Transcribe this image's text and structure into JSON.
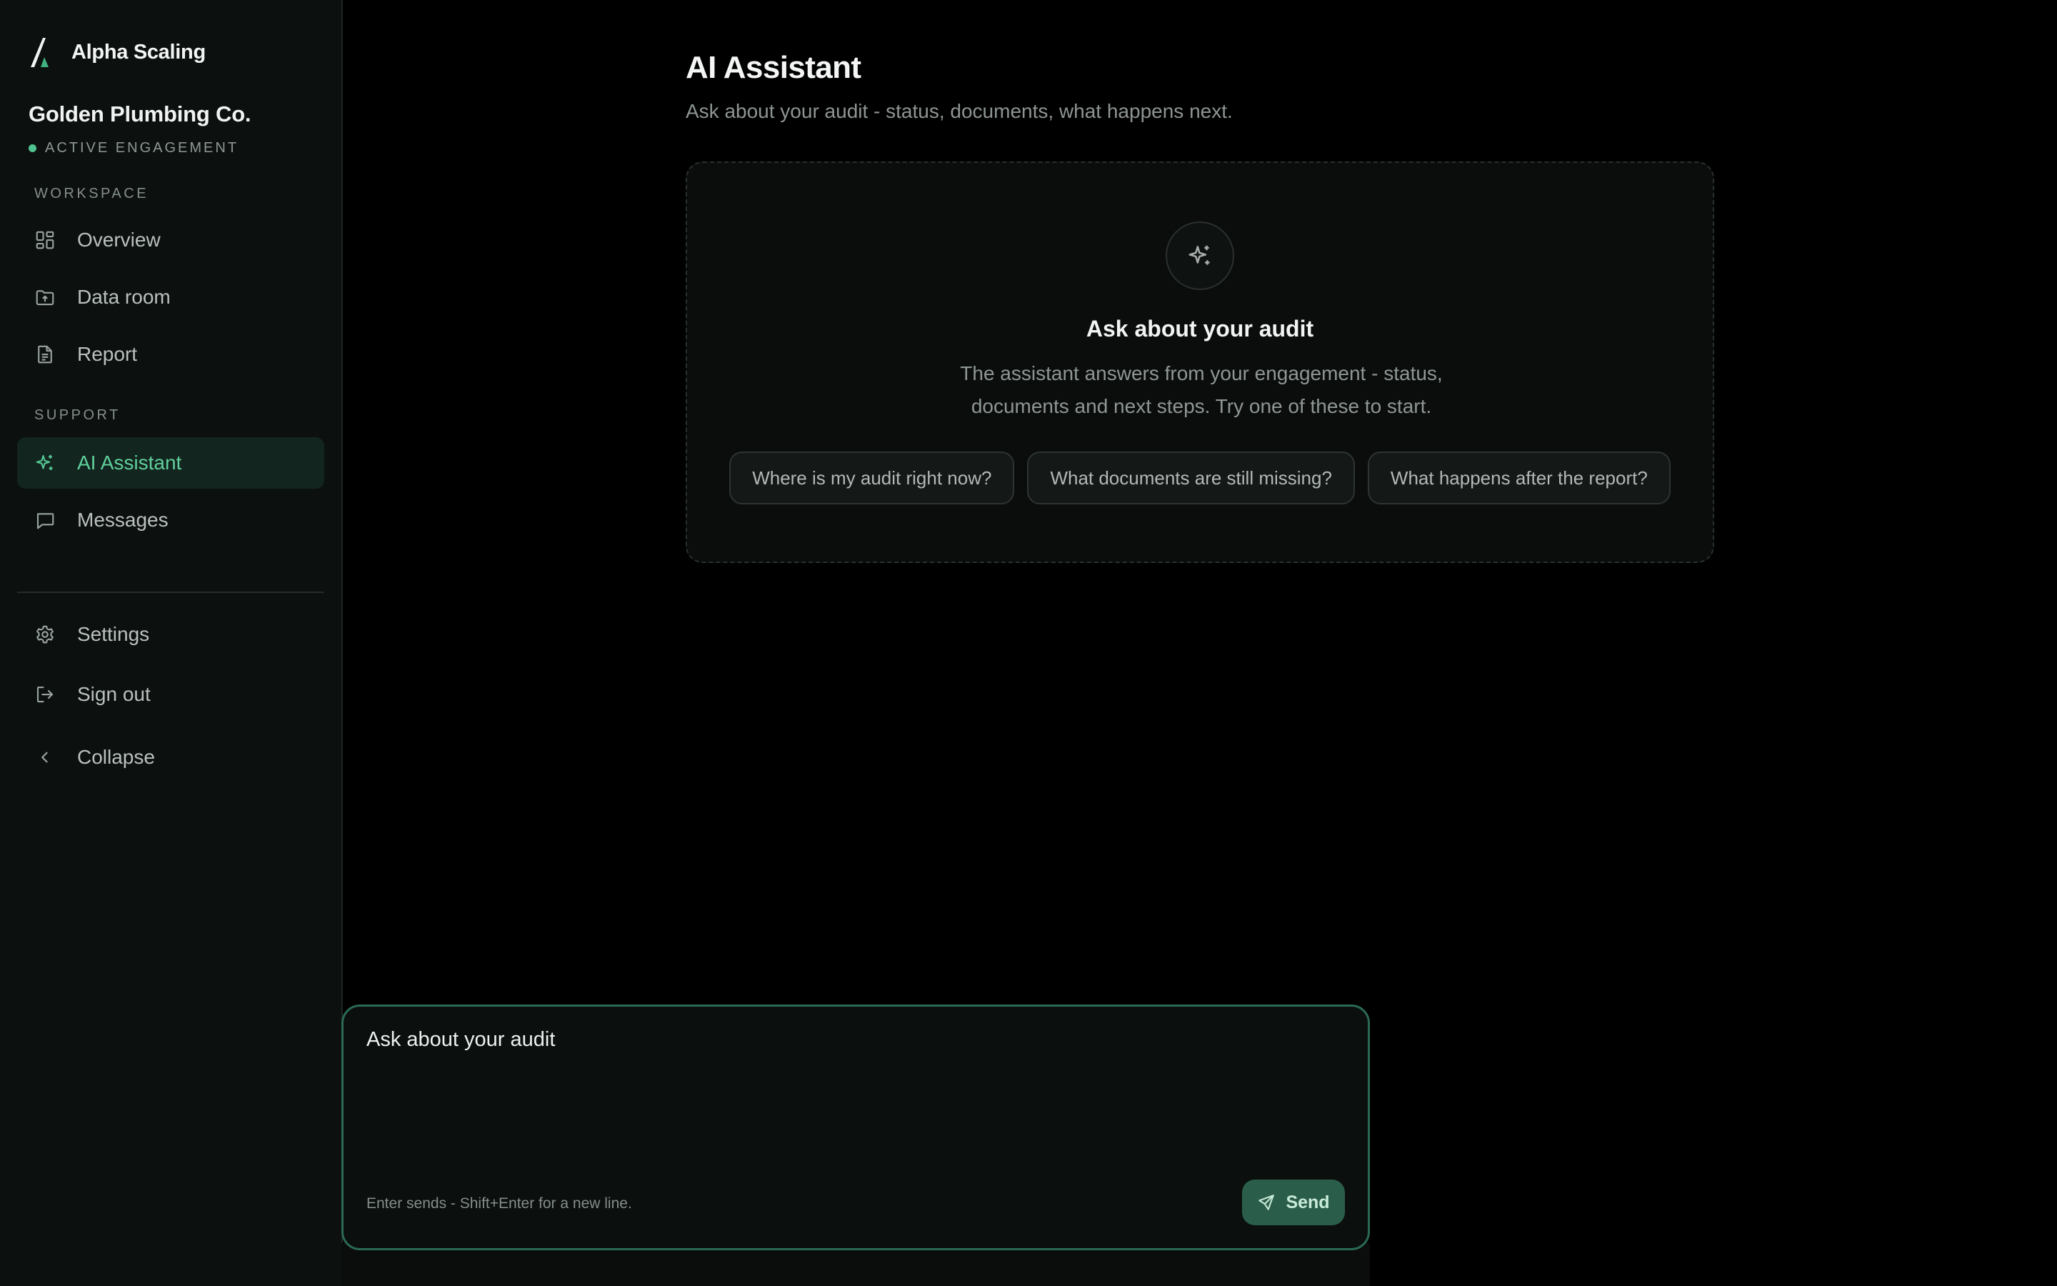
{
  "brand": {
    "name": "Alpha Scaling"
  },
  "client": {
    "name": "Golden Plumbing Co.",
    "status": "ACTIVE ENGAGEMENT",
    "status_color": "#4fc38f"
  },
  "sidebar": {
    "workspace_label": "WORKSPACE",
    "workspace_items": [
      {
        "label": "Overview",
        "icon": "grid-icon"
      },
      {
        "label": "Data room",
        "icon": "folder-upload-icon"
      },
      {
        "label": "Report",
        "icon": "document-icon"
      }
    ],
    "support_label": "SUPPORT",
    "support_items": [
      {
        "label": "AI Assistant",
        "icon": "sparkles-icon",
        "active": true
      },
      {
        "label": "Messages",
        "icon": "chat-bubble-icon"
      }
    ],
    "footer_items": [
      {
        "label": "Settings",
        "icon": "gear-icon"
      },
      {
        "label": "Sign out",
        "icon": "logout-icon"
      },
      {
        "label": "Collapse",
        "icon": "chevron-left-icon"
      }
    ]
  },
  "page": {
    "title": "AI Assistant",
    "subtitle": "Ask about your audit - status, documents, what happens next."
  },
  "empty_state": {
    "icon": "sparkles-icon",
    "title": "Ask about your audit",
    "description": "The assistant answers from your engagement - status, documents and next steps. Try one of these to start.",
    "suggestions": [
      "Where is my audit right now?",
      "What documents are still missing?",
      "What happens after the report?"
    ]
  },
  "composer": {
    "placeholder": "Ask about your audit",
    "value": "",
    "hint": "Enter sends - Shift+Enter for a new line.",
    "send_label": "Send",
    "send_icon": "send-icon"
  },
  "colors": {
    "accent": "#5fd09c",
    "active_bg": "#13251f",
    "sidebar_bg": "#0c1110",
    "send_button_bg": "#2b5e4a",
    "composer_border": "#2b6a52"
  }
}
